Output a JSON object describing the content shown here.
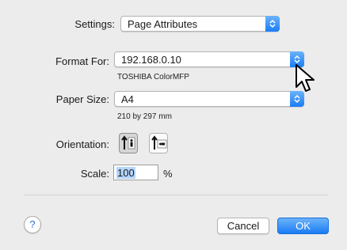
{
  "settings": {
    "label": "Settings:",
    "value": "Page Attributes"
  },
  "format_for": {
    "label": "Format For:",
    "value": "192.168.0.10",
    "printer_name": "TOSHIBA ColorMFP"
  },
  "paper_size": {
    "label": "Paper Size:",
    "value": "A4",
    "dimensions": "210 by 297 mm"
  },
  "orientation": {
    "label": "Orientation:",
    "options": [
      "portrait-icon",
      "landscape-icon"
    ],
    "selected": "portrait-icon"
  },
  "scale": {
    "label": "Scale:",
    "value": "100",
    "unit": "%"
  },
  "buttons": {
    "help": "?",
    "cancel": "Cancel",
    "ok": "OK"
  },
  "colors": {
    "accent": "#1a7cf5",
    "background": "#ececec"
  }
}
